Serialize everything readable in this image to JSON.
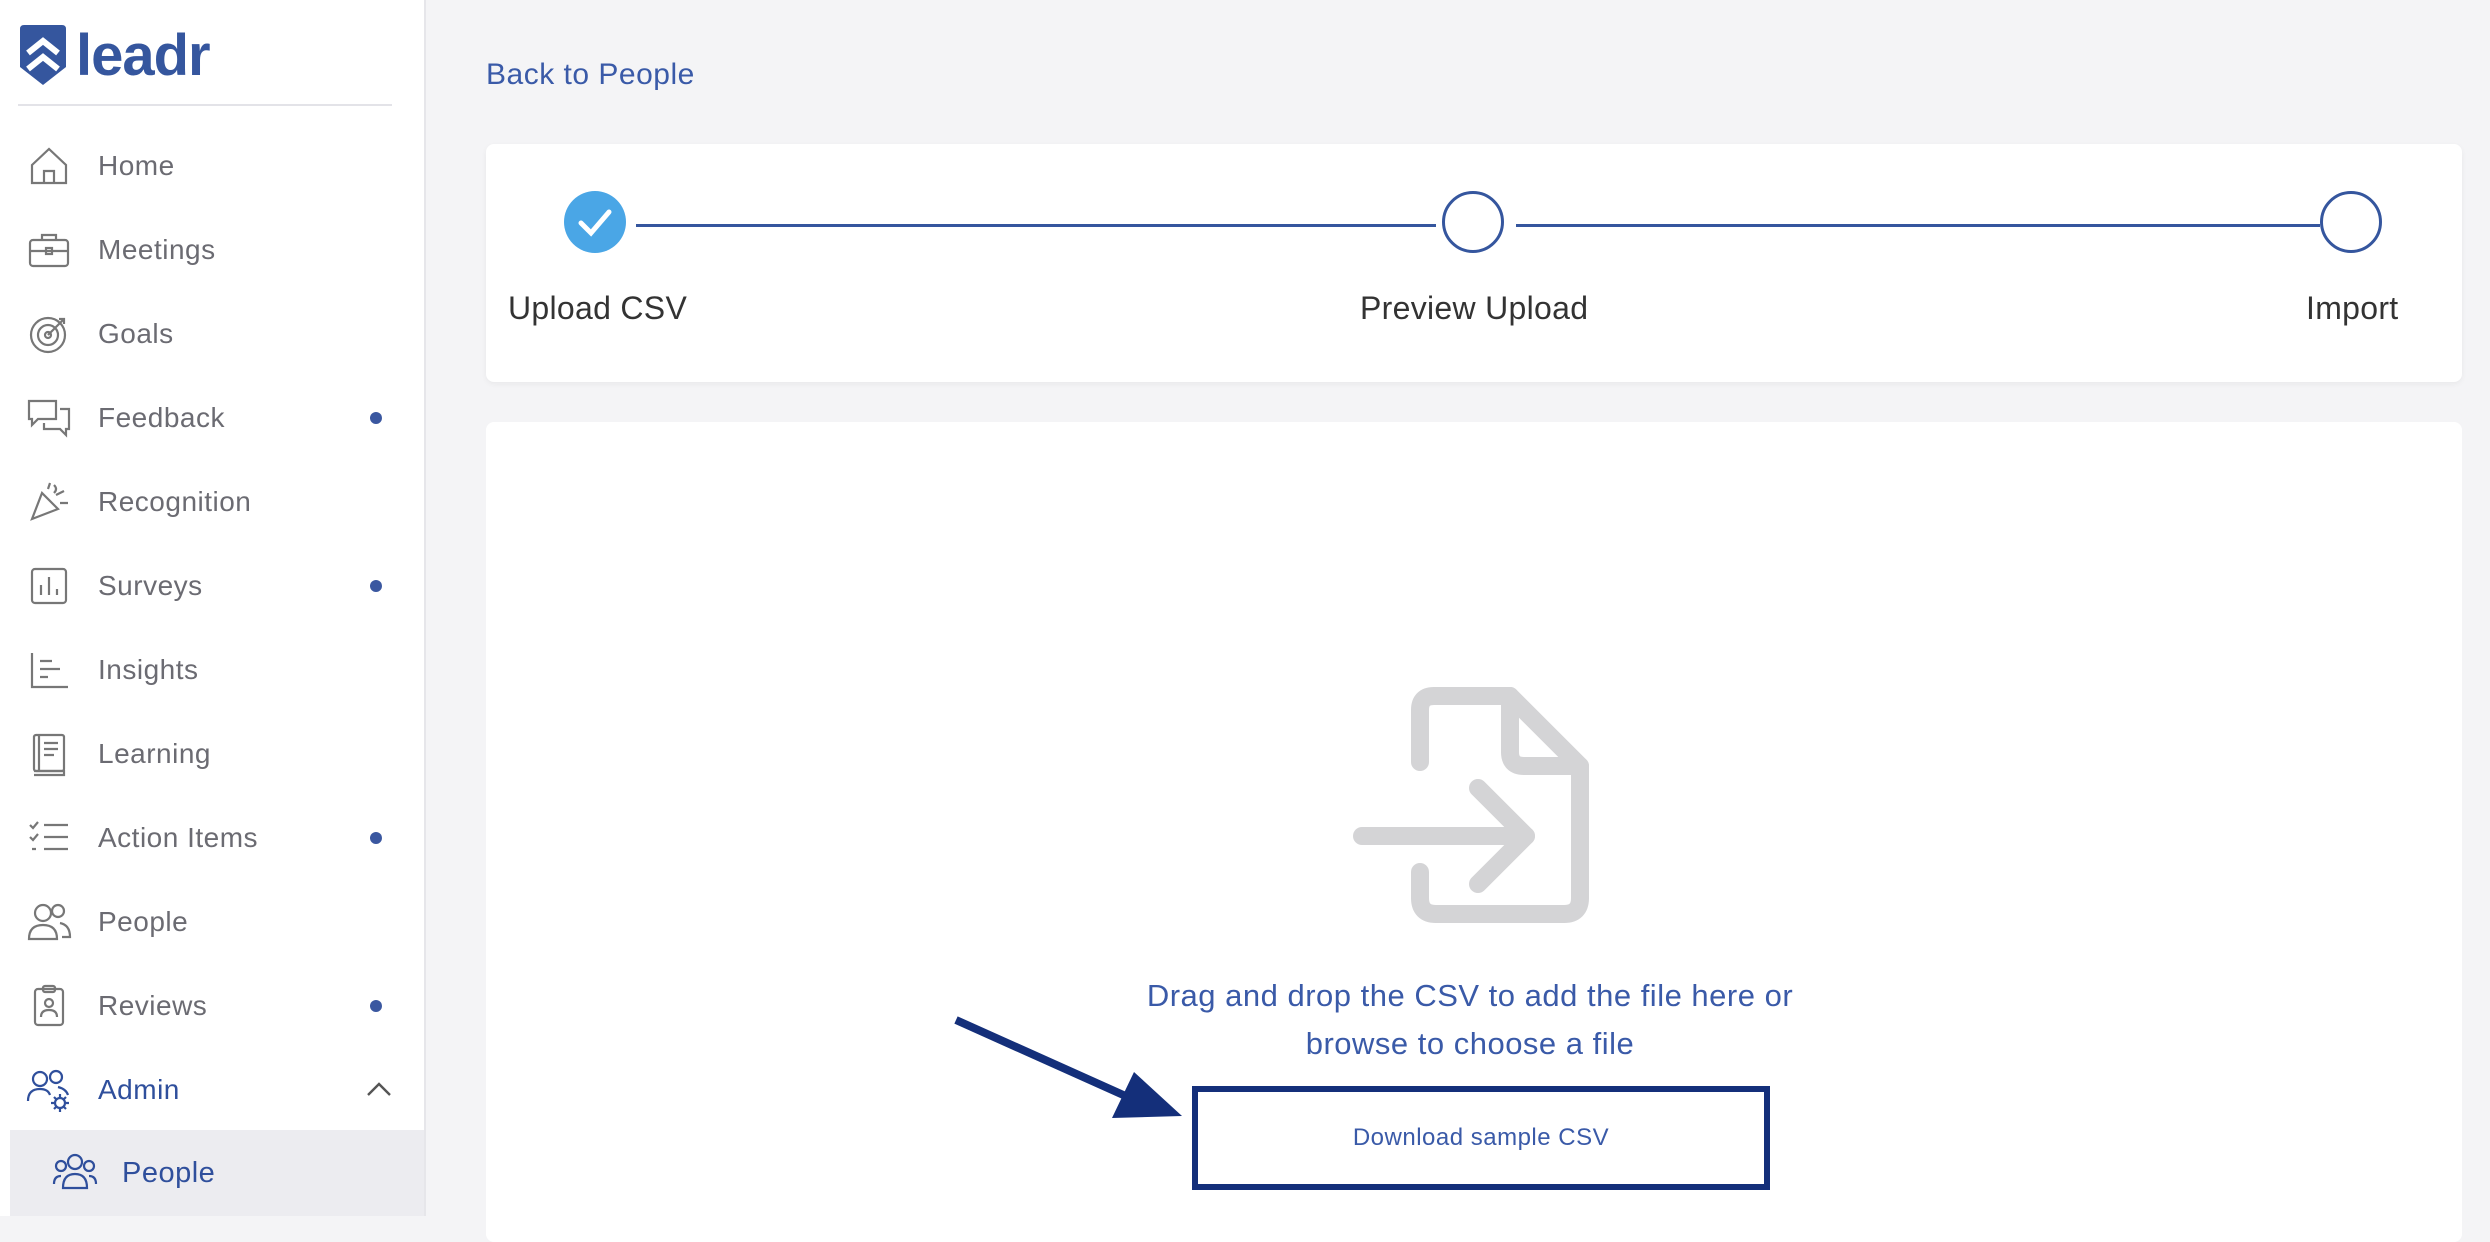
{
  "brand": {
    "name": "leadr",
    "color": "#35569e"
  },
  "sidebar": {
    "items": [
      {
        "label": "Home",
        "icon": "home-icon",
        "dot": false
      },
      {
        "label": "Meetings",
        "icon": "briefcase-icon",
        "dot": false
      },
      {
        "label": "Goals",
        "icon": "target-icon",
        "dot": false
      },
      {
        "label": "Feedback",
        "icon": "chat-bubbles-icon",
        "dot": true
      },
      {
        "label": "Recognition",
        "icon": "party-popper-icon",
        "dot": false
      },
      {
        "label": "Surveys",
        "icon": "bar-chart-icon",
        "dot": true
      },
      {
        "label": "Insights",
        "icon": "insights-icon",
        "dot": false
      },
      {
        "label": "Learning",
        "icon": "book-icon",
        "dot": false
      },
      {
        "label": "Action Items",
        "icon": "checklist-icon",
        "dot": true
      },
      {
        "label": "People",
        "icon": "people-icon",
        "dot": false
      },
      {
        "label": "Reviews",
        "icon": "clipboard-badge-icon",
        "dot": true
      },
      {
        "label": "Admin",
        "icon": "admin-people-gear-icon",
        "dot": false
      }
    ],
    "sub_items": [
      {
        "label": "People",
        "icon": "people-icon"
      }
    ]
  },
  "main": {
    "back_link": "Back to People",
    "steps": [
      {
        "label": "Upload CSV",
        "status": "done"
      },
      {
        "label": "Preview Upload",
        "status": "pending"
      },
      {
        "label": "Import",
        "status": "pending"
      }
    ],
    "upload": {
      "icon": "file-import-icon",
      "instructions_line1": "Drag and drop the CSV to add the file here or",
      "instructions_line2": "browse to choose a file",
      "download_button": "Download sample CSV"
    }
  },
  "colors": {
    "accent": "#3a5aa8",
    "step_done": "#4aa6e6",
    "highlight_border": "#142f7a"
  }
}
